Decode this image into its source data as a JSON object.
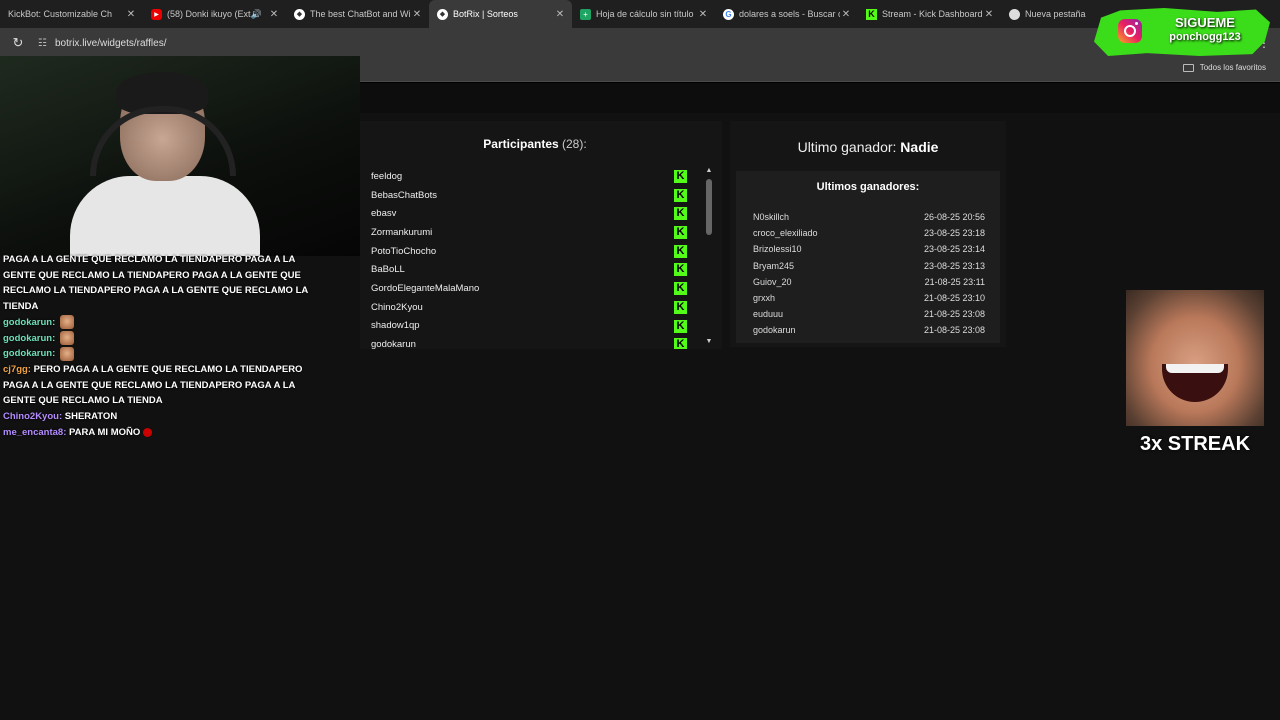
{
  "browser": {
    "tabs": [
      {
        "title": "KickBot: Customizable Ch",
        "icon": "kickbot-icon",
        "active": false
      },
      {
        "title": "(58) Donki ikuyo (Exte",
        "icon": "youtube-icon",
        "active": false,
        "audio": true
      },
      {
        "title": "The best ChatBot and Wi",
        "icon": "botrix-icon",
        "active": false
      },
      {
        "title": "BotRix | Sorteos",
        "icon": "botrix-icon",
        "active": true
      },
      {
        "title": "Hoja de cálculo sin título",
        "icon": "sheets-icon",
        "active": false
      },
      {
        "title": "dolares a soels - Buscar c",
        "icon": "google-icon",
        "active": false
      },
      {
        "title": "Stream - Kick Dashboard",
        "icon": "kick-icon",
        "active": false
      },
      {
        "title": "Nueva pestaña",
        "icon": "chrome-icon",
        "active": false
      }
    ],
    "url": "botrix.live/widgets/raffles/",
    "bookmarks_all": "Todos los favoritos"
  },
  "raffle": {
    "participants_label": "Participantes",
    "participants_count": "(28):",
    "participants": [
      "feeldog",
      "BebasChatBots",
      "ebasv",
      "Zormankurumi",
      "PotoTioChocho",
      "BaBoLL",
      "GordoEleganteMalaMano",
      "Chino2Kyou",
      "shadow1qp",
      "godokarun"
    ],
    "badge_letter": "K",
    "last_winner_label": "Ultimo ganador:",
    "last_winner_value": "Nadie",
    "winners_title": "Ultimos ganadores:",
    "winners": [
      {
        "name": "N0skillch",
        "date": "26-08-25 20:56"
      },
      {
        "name": "croco_elexiliado",
        "date": "23-08-25 23:18"
      },
      {
        "name": "Brizolessi10",
        "date": "23-08-25 23:14"
      },
      {
        "name": "Bryam245",
        "date": "23-08-25 23:13"
      },
      {
        "name": "Guiov_20",
        "date": "21-08-25 23:11"
      },
      {
        "name": "grxxh",
        "date": "21-08-25 23:10"
      },
      {
        "name": "euduuu",
        "date": "21-08-25 23:08"
      },
      {
        "name": "godokarun",
        "date": "21-08-25 23:08"
      }
    ]
  },
  "chat": [
    {
      "user": "",
      "text": "PAGA A LA GENTE QUE RECLAMO LA TIENDAPERO PAGA A LA GENTE QUE RECLAMO LA TIENDAPERO PAGA A LA GENTE QUE RECLAMO LA TIENDAPERO PAGA A LA GENTE QUE RECLAMO LA TIENDA",
      "color": "#ffffff"
    },
    {
      "user": "godokarun:",
      "text": "",
      "color": "#6fe0b8",
      "emote": true
    },
    {
      "user": "godokarun:",
      "text": "",
      "color": "#6fe0b8",
      "emote": true
    },
    {
      "user": "godokarun:",
      "text": "",
      "color": "#6fe0b8",
      "emote": true
    },
    {
      "user": "cj7gg:",
      "text": "PERO PAGA A LA GENTE QUE RECLAMO LA TIENDAPERO PAGA A LA GENTE QUE RECLAMO LA TIENDAPERO PAGA A LA GENTE QUE RECLAMO LA TIENDA",
      "color": "#f0a34a"
    },
    {
      "user": "Chino2Kyou:",
      "text": "SHERATON",
      "color": "#b48cff"
    },
    {
      "user": "me_encanta8:",
      "text": "PARA MI MOÑO",
      "color": "#b48cff",
      "heart": true
    }
  ],
  "overlay": {
    "instagram_title": "SIGUEME",
    "instagram_handle": "ponchogg123",
    "streak_text": "3x STREAK"
  },
  "colors": {
    "kick_green": "#53fc18",
    "panel_bg": "#151515",
    "page_bg": "#111111"
  }
}
